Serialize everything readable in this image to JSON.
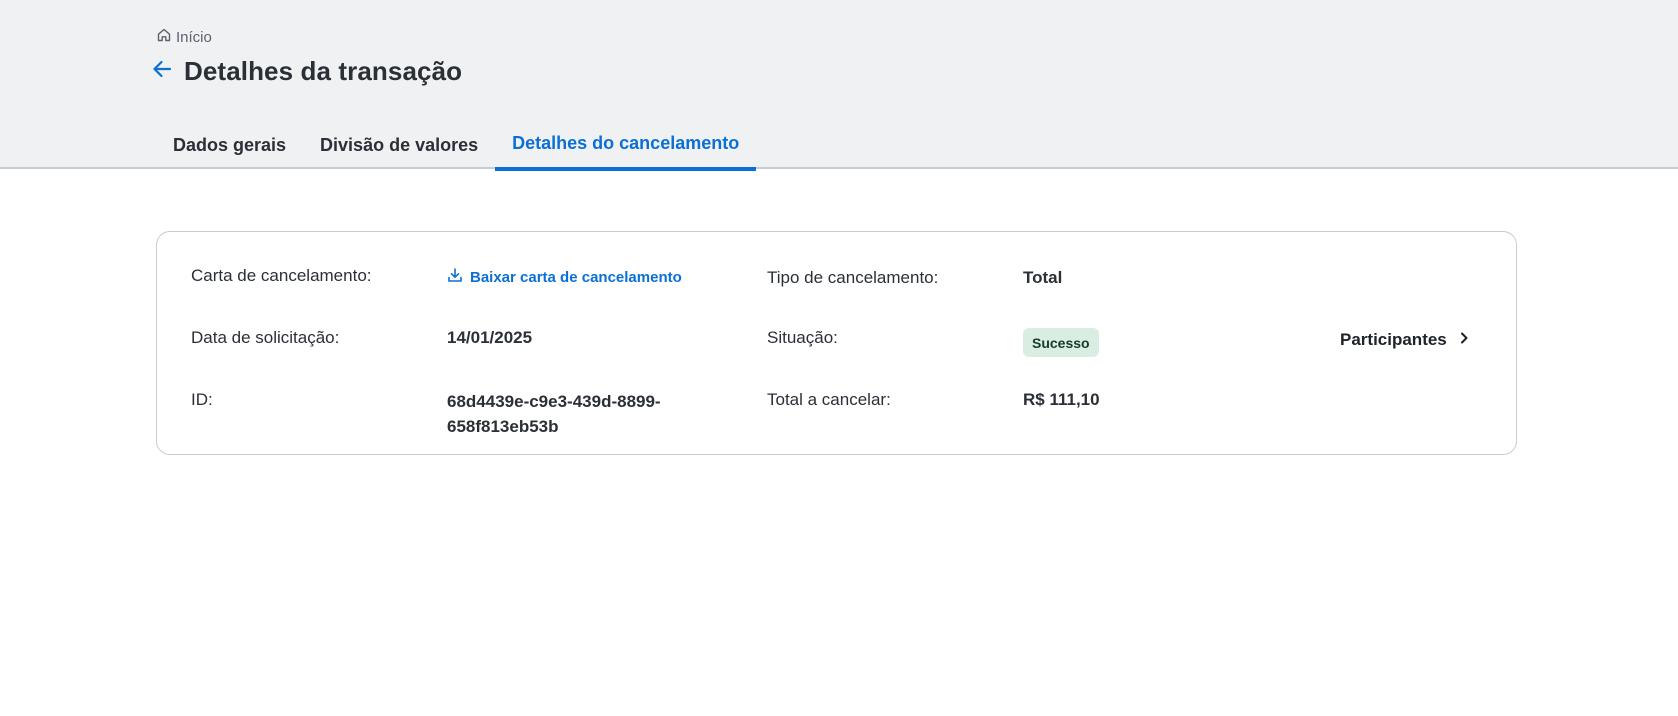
{
  "breadcrumb": {
    "label": "Início",
    "icon": "home-icon"
  },
  "header": {
    "title": "Detalhes da transação",
    "back_icon": "arrow-left-icon"
  },
  "tabs": [
    {
      "label": "Dados gerais",
      "active": false
    },
    {
      "label": "Divisão de valores",
      "active": false
    },
    {
      "label": "Detalhes do cancelamento",
      "active": true
    }
  ],
  "details": {
    "letter_label": "Carta de cancelamento:",
    "download_label": "Baixar carta de cancelamento",
    "download_icon": "download-icon",
    "request_date_label": "Data de solicitação:",
    "request_date_value": "14/01/2025",
    "id_label": "ID:",
    "id_value": "68d4439e-c9e3-439d-8899-658f813eb53b",
    "type_label": "Tipo de cancelamento:",
    "type_value": "Total",
    "status_label": "Situação:",
    "status_value": "Sucesso",
    "total_label": "Total a cancelar:",
    "total_value": "R$ 111,10",
    "participants_label": "Participantes",
    "participants_icon": "chevron-right-icon"
  },
  "colors": {
    "accent": "#0b6fd6",
    "header_bg": "#f0f1f3",
    "success_badge_bg": "#d9ede3",
    "success_badge_text": "#143d2b"
  }
}
